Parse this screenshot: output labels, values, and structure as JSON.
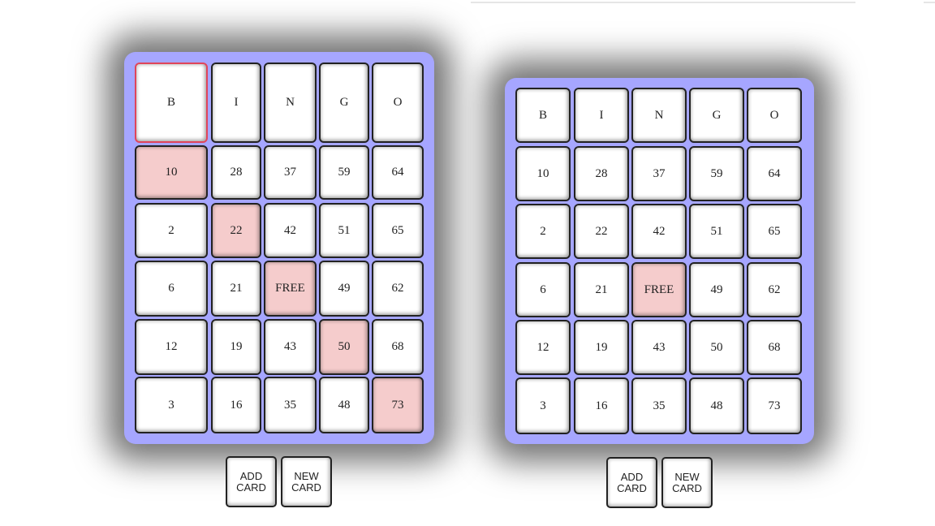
{
  "cards": [
    {
      "header": [
        "B",
        "I",
        "N",
        "G",
        "O"
      ],
      "rows": [
        [
          "10",
          "28",
          "37",
          "59",
          "64"
        ],
        [
          "2",
          "22",
          "42",
          "51",
          "65"
        ],
        [
          "6",
          "21",
          "FREE",
          "49",
          "62"
        ],
        [
          "12",
          "19",
          "43",
          "50",
          "68"
        ],
        [
          "3",
          "16",
          "35",
          "48",
          "73"
        ]
      ],
      "marked": [
        [
          0,
          0
        ],
        [
          1,
          1
        ],
        [
          2,
          2
        ],
        [
          3,
          3
        ],
        [
          4,
          4
        ]
      ],
      "selected_header": 0
    },
    {
      "header": [
        "B",
        "I",
        "N",
        "G",
        "O"
      ],
      "rows": [
        [
          "10",
          "28",
          "37",
          "59",
          "64"
        ],
        [
          "2",
          "22",
          "42",
          "51",
          "65"
        ],
        [
          "6",
          "21",
          "FREE",
          "49",
          "62"
        ],
        [
          "12",
          "19",
          "43",
          "50",
          "68"
        ],
        [
          "3",
          "16",
          "35",
          "48",
          "73"
        ]
      ],
      "marked": [
        [
          2,
          2
        ]
      ],
      "selected_header": null
    }
  ],
  "buttons": {
    "add_card": "ADD\nCARD",
    "new_card": "NEW\nCARD"
  },
  "colors": {
    "card_background": "#a6a6ff",
    "marked_cell": "#f5cccc",
    "selected_border": "#e0455a"
  }
}
